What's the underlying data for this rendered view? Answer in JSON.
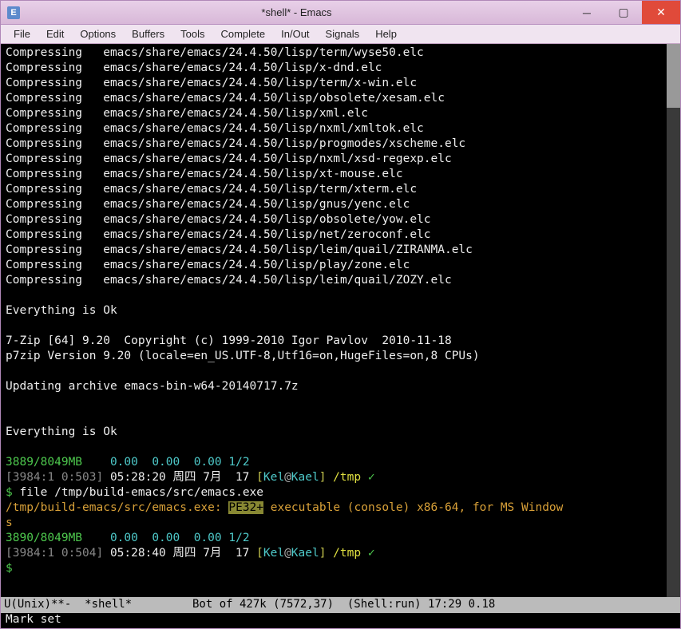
{
  "titlebar": {
    "icon_letter": "E",
    "title": "*shell* - Emacs"
  },
  "win_controls": {
    "min": "─",
    "max": "▢",
    "close": "✕"
  },
  "menubar": [
    "File",
    "Edit",
    "Options",
    "Buffers",
    "Tools",
    "Complete",
    "In/Out",
    "Signals",
    "Help"
  ],
  "compress_prefix": "Compressing   ",
  "compress_paths": [
    "emacs/share/emacs/24.4.50/lisp/term/wyse50.elc",
    "emacs/share/emacs/24.4.50/lisp/x-dnd.elc",
    "emacs/share/emacs/24.4.50/lisp/term/x-win.elc",
    "emacs/share/emacs/24.4.50/lisp/obsolete/xesam.elc",
    "emacs/share/emacs/24.4.50/lisp/xml.elc",
    "emacs/share/emacs/24.4.50/lisp/nxml/xmltok.elc",
    "emacs/share/emacs/24.4.50/lisp/progmodes/xscheme.elc",
    "emacs/share/emacs/24.4.50/lisp/nxml/xsd-regexp.elc",
    "emacs/share/emacs/24.4.50/lisp/xt-mouse.elc",
    "emacs/share/emacs/24.4.50/lisp/term/xterm.elc",
    "emacs/share/emacs/24.4.50/lisp/gnus/yenc.elc",
    "emacs/share/emacs/24.4.50/lisp/obsolete/yow.elc",
    "emacs/share/emacs/24.4.50/lisp/net/zeroconf.elc",
    "emacs/share/emacs/24.4.50/lisp/leim/quail/ZIRANMA.elc",
    "emacs/share/emacs/24.4.50/lisp/play/zone.elc",
    "emacs/share/emacs/24.4.50/lisp/leim/quail/ZOZY.elc"
  ],
  "ok_line": "Everything is Ok",
  "sevenzip_line": "7-Zip [64] 9.20  Copyright (c) 1999-2010 Igor Pavlov  2010-11-18",
  "p7zip_line": "p7zip Version 9.20 (locale=en_US.UTF-8,Utf16=on,HugeFiles=on,8 CPUs)",
  "updating_line": "Updating archive emacs-bin-w64-20140717.7z",
  "mem1": "3889/8049MB",
  "loads": "    0.00  0.00  0.00 1/2",
  "prompt1_dim": "[3984:1 0:503]",
  "prompt1_time": " 05:28:20 周四 7月  17 ",
  "prompt1_user": "Kel",
  "prompt1_at": "@",
  "prompt1_host": "Kael",
  "prompt1_cwd": " /tmp ",
  "prompt1_tick": "✓",
  "prompt_dollar": "$ ",
  "command1": "file /tmp/build-emacs/src/emacs.exe",
  "file_out_path": "/tmp/build-emacs/src/emacs.exe: ",
  "file_out_pe": "PE32+",
  "file_out_rest": " executable (console) x86-64, for MS Window",
  "file_out_cont": "s",
  "mem2": "3890/8049MB",
  "prompt2_dim": "[3984:1 0:504]",
  "prompt2_time": " 05:28:40 周四 7月  17 ",
  "modeline": "U(Unix)**-  *shell*         Bot of 427k (7572,37)  (Shell:run) 17:29 0.18",
  "echo": "Mark set"
}
